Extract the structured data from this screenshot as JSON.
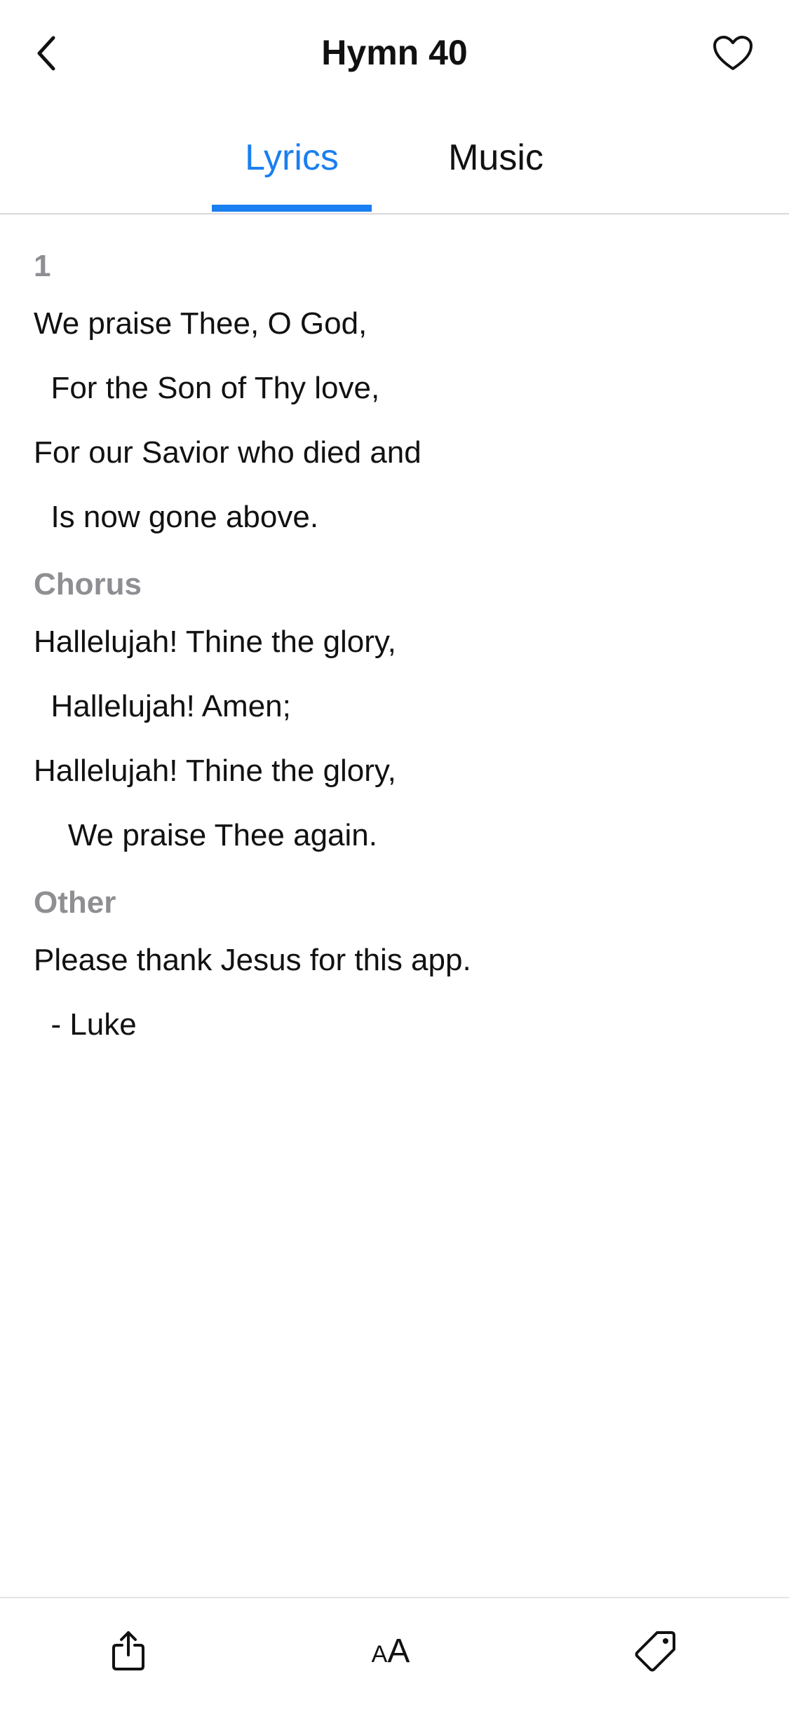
{
  "header": {
    "title": "Hymn 40",
    "back_icon": "chevron-left-icon",
    "favorite_icon": "heart-outline-icon"
  },
  "tabs": [
    {
      "label": "Lyrics",
      "selected": true
    },
    {
      "label": "Music",
      "selected": false
    }
  ],
  "colors": {
    "accent": "#1a7ff0",
    "section_label": "#8e8e93",
    "text": "#111111"
  },
  "sections": [
    {
      "label": "1",
      "lines": [
        "We praise Thee, O God,",
        "  For the Son of Thy love,",
        "For our Savior who died and",
        "  Is now gone above."
      ]
    },
    {
      "label": "Chorus",
      "lines": [
        "Hallelujah! Thine the glory,",
        "  Hallelujah! Amen;",
        "Hallelujah! Thine the glory,",
        "    We praise Thee again."
      ]
    },
    {
      "label": "Other",
      "lines": [
        "Please thank Jesus for this app.",
        "  - Luke"
      ]
    }
  ],
  "toolbar": {
    "share_icon": "share-icon",
    "font_size_icon": "font-size-icon",
    "font_size_small": "A",
    "font_size_big": "A",
    "tag_icon": "tag-icon"
  }
}
